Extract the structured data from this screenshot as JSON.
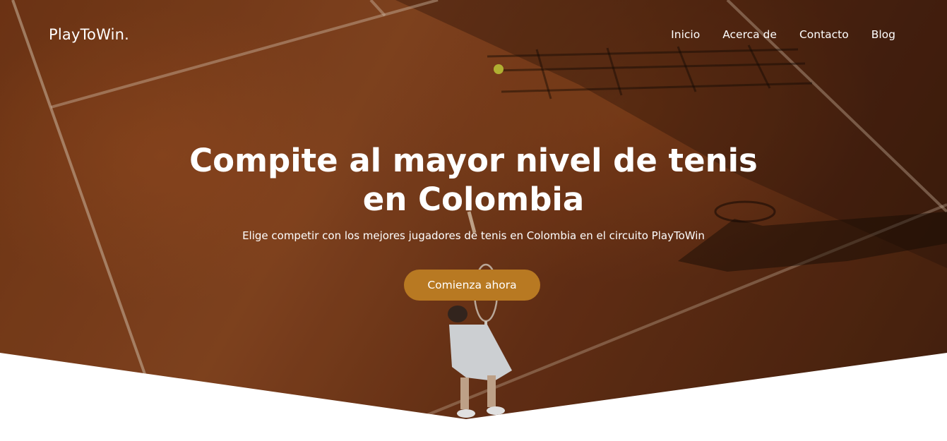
{
  "header": {
    "logo": "PlayToWin.",
    "nav": [
      {
        "label": "Inicio"
      },
      {
        "label": "Acerca de"
      },
      {
        "label": "Contacto"
      },
      {
        "label": "Blog"
      }
    ]
  },
  "hero": {
    "headline_line1": "Compite al mayor nivel de tenis",
    "headline_line2": "en Colombia",
    "subtitle": "Elige competir con los mejores jugadores de tenis en Colombia en el circuito PlayToWin",
    "cta_label": "Comienza ahora",
    "background": "clay-court-tennis-serve-photo"
  },
  "colors": {
    "accent": "#b87922",
    "court": "#8f4a22",
    "text": "#ffffff"
  }
}
